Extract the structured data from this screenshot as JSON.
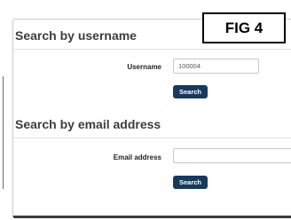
{
  "figure_label": "FIG 4",
  "username_section": {
    "title": "Search by username",
    "field_label": "Username",
    "field_value": "100004",
    "button_label": "Search"
  },
  "email_section": {
    "title": "Search by email address",
    "field_label": "Email address",
    "field_value": "",
    "button_label": "Search"
  },
  "colors": {
    "button_bg": "#163a5e",
    "button_text": "#ffffff",
    "panel_border": "#c8cdd2"
  }
}
